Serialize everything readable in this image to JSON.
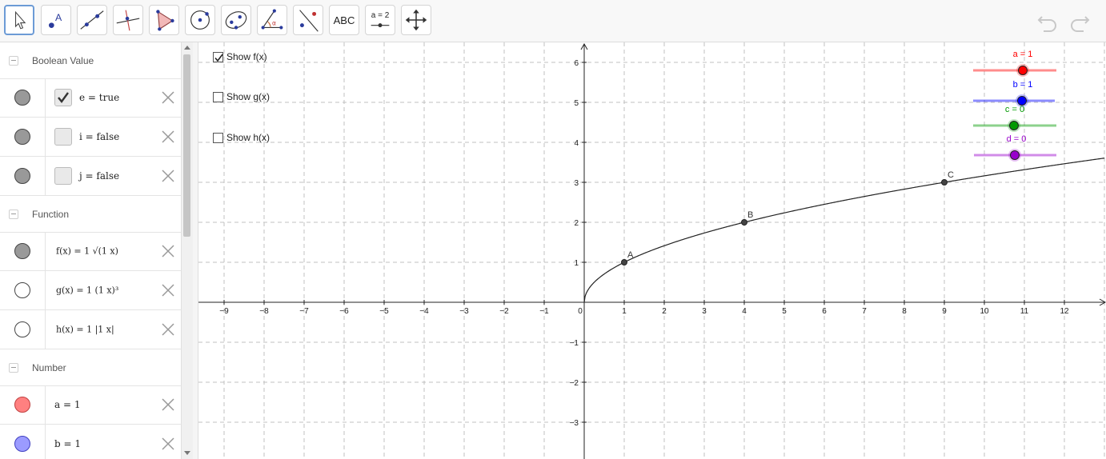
{
  "toolbar": {
    "tools": [
      {
        "name": "move-tool",
        "icon": "arrow-pointer-icon"
      },
      {
        "name": "point-tool",
        "icon": "point-icon"
      },
      {
        "name": "line-tool",
        "icon": "line-through-points-icon"
      },
      {
        "name": "perpendicular-tool",
        "icon": "perpendicular-line-icon"
      },
      {
        "name": "polygon-tool",
        "icon": "polygon-icon"
      },
      {
        "name": "circle-center-tool",
        "icon": "circle-center-icon"
      },
      {
        "name": "ellipse-tool",
        "icon": "ellipse-icon"
      },
      {
        "name": "angle-tool",
        "icon": "angle-icon"
      },
      {
        "name": "reflect-tool",
        "icon": "reflect-about-line-icon"
      },
      {
        "name": "text-tool",
        "label": "ABC"
      },
      {
        "name": "slider-tool",
        "label": "a = 2"
      },
      {
        "name": "move-graphics-view-tool",
        "icon": "move-arrows-icon"
      }
    ],
    "undo_icon": "undo-icon",
    "redo_icon": "redo-icon"
  },
  "algebra": {
    "categories": [
      {
        "title": "Boolean Value",
        "items": [
          {
            "text": "e = true",
            "checked": true,
            "color": "#999999"
          },
          {
            "text": "i = false",
            "checked": false,
            "color": "#999999"
          },
          {
            "text": "j = false",
            "checked": false,
            "color": "#999999"
          }
        ]
      },
      {
        "title": "Function",
        "items": [
          {
            "text": "f(x) = 1 √(1 x)",
            "visible": true,
            "color": "#999999"
          },
          {
            "text": "g(x) = 1 (1 x)³",
            "visible": false,
            "color": "#ffffff"
          },
          {
            "text": "h(x) = 1 |1 x|",
            "visible": false,
            "color": "#ffffff"
          }
        ]
      },
      {
        "title": "Number",
        "items": [
          {
            "text": "a = 1",
            "color": "#ff8080"
          },
          {
            "text": "b = 1",
            "color": "#9b9bff"
          }
        ]
      }
    ]
  },
  "graphics": {
    "checkboxes": [
      {
        "label": "Show f(x)",
        "checked": true
      },
      {
        "label": "Show g(x)",
        "checked": false
      },
      {
        "label": "Show h(x)",
        "checked": false
      }
    ],
    "sliders": [
      {
        "label": "a = 1",
        "value": 1,
        "color": "#ff0000"
      },
      {
        "label": "b = 1",
        "value": 1,
        "color": "#0000ff"
      },
      {
        "label": "c = 0",
        "value": 0,
        "color": "#009900"
      },
      {
        "label": "d = 0",
        "value": 0,
        "color": "#9900cc"
      }
    ],
    "points": [
      {
        "label": "A",
        "x": 1,
        "y": 1
      },
      {
        "label": "B",
        "x": 4,
        "y": 2
      },
      {
        "label": "C",
        "x": 9,
        "y": 3
      }
    ],
    "function_curve": "f(x) = sqrt(x)",
    "x_ticks": [
      "-9",
      "-8",
      "-7",
      "-6",
      "-5",
      "-4",
      "-3",
      "-2",
      "-1",
      "0",
      "1",
      "2",
      "3",
      "4",
      "5",
      "6",
      "7",
      "8",
      "9",
      "10",
      "11",
      "12"
    ],
    "y_ticks": [
      "6",
      "5",
      "4",
      "3",
      "2",
      "1",
      "-1",
      "-2",
      "-3"
    ],
    "x_range": [
      -9.5,
      13
    ],
    "y_range": [
      -3.9,
      6.5
    ],
    "grid": true
  }
}
